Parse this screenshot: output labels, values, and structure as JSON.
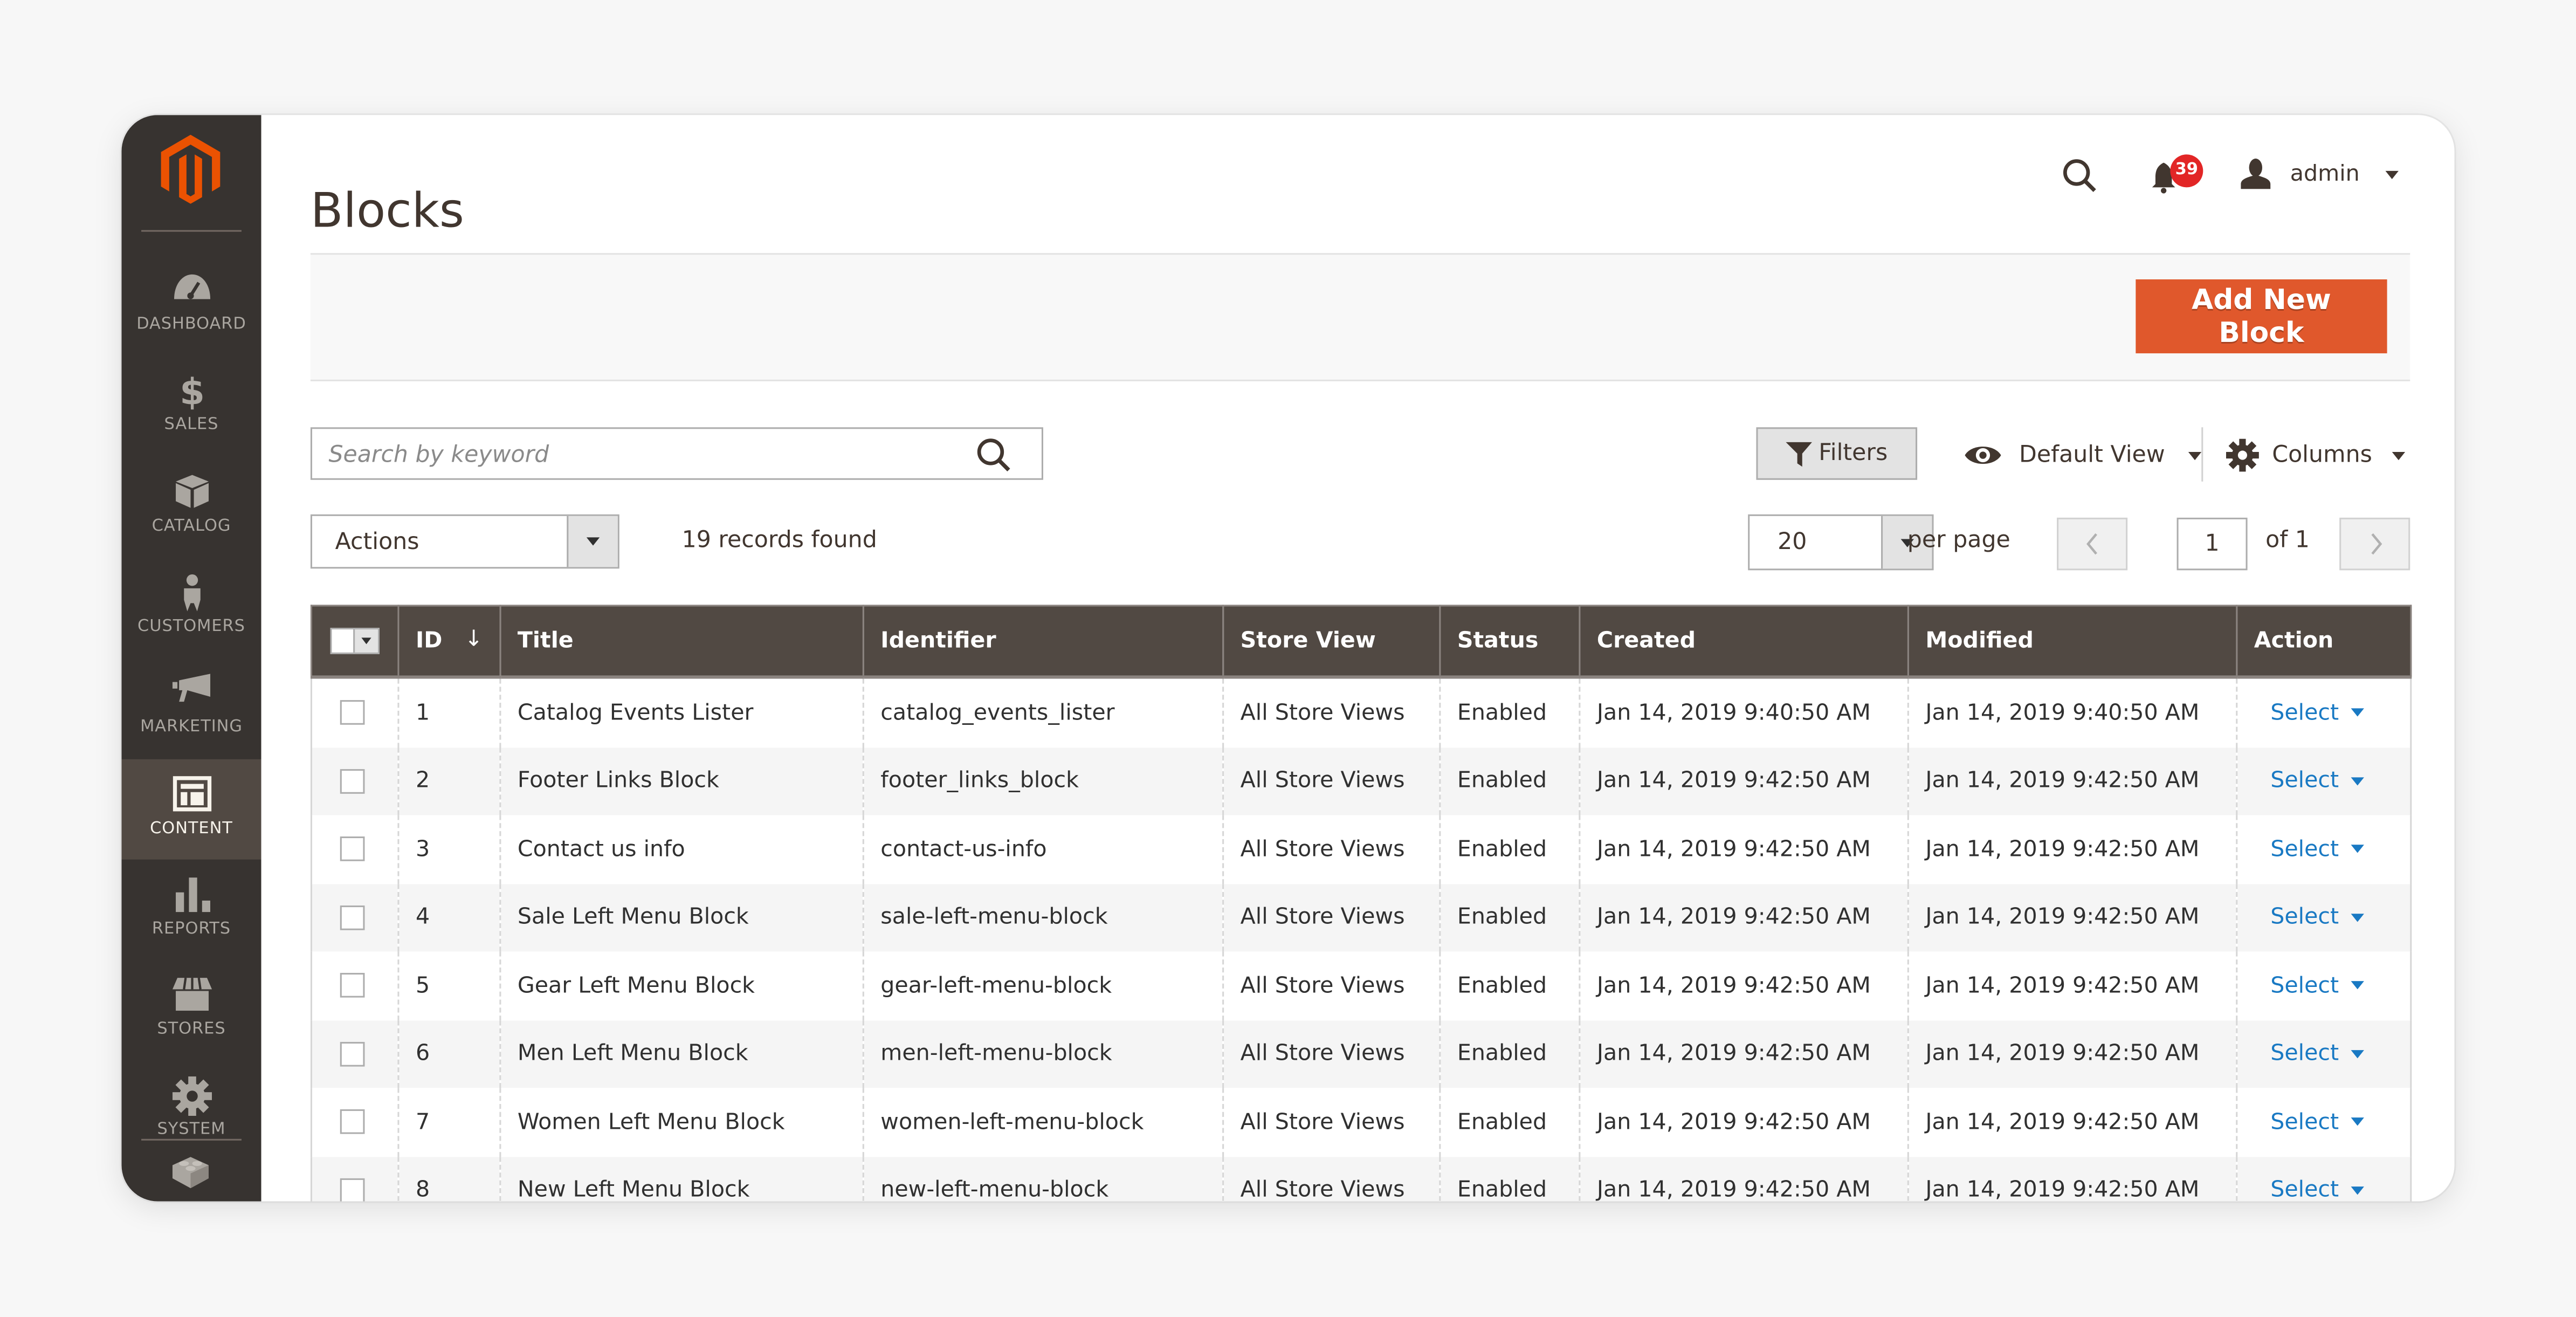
{
  "sidebar": {
    "logo": "magento-logo",
    "items": [
      {
        "label": "DASHBOARD",
        "icon": "dashboard-gauge-icon",
        "active": false
      },
      {
        "label": "SALES",
        "icon": "dollar-icon",
        "active": false
      },
      {
        "label": "CATALOG",
        "icon": "box-icon",
        "active": false
      },
      {
        "label": "CUSTOMERS",
        "icon": "person-icon",
        "active": false
      },
      {
        "label": "MARKETING",
        "icon": "megaphone-icon",
        "active": false
      },
      {
        "label": "CONTENT",
        "icon": "layout-icon",
        "active": true
      },
      {
        "label": "REPORTS",
        "icon": "bar-chart-icon",
        "active": false
      },
      {
        "label": "STORES",
        "icon": "storefront-icon",
        "active": false
      },
      {
        "label": "SYSTEM",
        "icon": "gear-icon",
        "active": false
      }
    ],
    "extra_icon": "lego-brick-icon"
  },
  "header": {
    "title": "Blocks",
    "notifications_count": "39",
    "user": "admin"
  },
  "toolbar": {
    "add_button": "Add New Block",
    "search_placeholder": "Search by keyword",
    "filters_label": "Filters",
    "view_label": "Default View",
    "columns_label": "Columns",
    "actions_label": "Actions",
    "records_found": "19 records found",
    "per_page_value": "20",
    "per_page_label": "per page",
    "current_page": "1",
    "total_pages_label": "of 1"
  },
  "colors": {
    "accent": "#e0582c",
    "sidebar_bg": "#373330",
    "table_header_bg": "#514943",
    "link": "#1979c3",
    "badge": "#e22626"
  },
  "table": {
    "columns": [
      "ID",
      "Title",
      "Identifier",
      "Store View",
      "Status",
      "Created",
      "Modified",
      "Action"
    ],
    "rows": [
      {
        "id": "1",
        "title": "Catalog Events Lister",
        "identifier": "catalog_events_lister",
        "store_view": "All Store Views",
        "status": "Enabled",
        "created": "Jan 14, 2019 9:40:50 AM",
        "modified": "Jan 14, 2019 9:40:50 AM",
        "action": "Select"
      },
      {
        "id": "2",
        "title": "Footer Links Block",
        "identifier": "footer_links_block",
        "store_view": "All Store Views",
        "status": "Enabled",
        "created": "Jan 14, 2019 9:42:50 AM",
        "modified": "Jan 14, 2019 9:42:50 AM",
        "action": "Select"
      },
      {
        "id": "3",
        "title": "Contact us info",
        "identifier": "contact-us-info",
        "store_view": "All Store Views",
        "status": "Enabled",
        "created": "Jan 14, 2019 9:42:50 AM",
        "modified": "Jan 14, 2019 9:42:50 AM",
        "action": "Select"
      },
      {
        "id": "4",
        "title": "Sale Left Menu Block",
        "identifier": "sale-left-menu-block",
        "store_view": "All Store Views",
        "status": "Enabled",
        "created": "Jan 14, 2019 9:42:50 AM",
        "modified": "Jan 14, 2019 9:42:50 AM",
        "action": "Select"
      },
      {
        "id": "5",
        "title": "Gear Left Menu Block",
        "identifier": "gear-left-menu-block",
        "store_view": "All Store Views",
        "status": "Enabled",
        "created": "Jan 14, 2019 9:42:50 AM",
        "modified": "Jan 14, 2019 9:42:50 AM",
        "action": "Select"
      },
      {
        "id": "6",
        "title": "Men Left Menu Block",
        "identifier": "men-left-menu-block",
        "store_view": "All Store Views",
        "status": "Enabled",
        "created": "Jan 14, 2019 9:42:50 AM",
        "modified": "Jan 14, 2019 9:42:50 AM",
        "action": "Select"
      },
      {
        "id": "7",
        "title": "Women Left Menu Block",
        "identifier": "women-left-menu-block",
        "store_view": "All Store Views",
        "status": "Enabled",
        "created": "Jan 14, 2019 9:42:50 AM",
        "modified": "Jan 14, 2019 9:42:50 AM",
        "action": "Select"
      },
      {
        "id": "8",
        "title": "New Left Menu Block",
        "identifier": "new-left-menu-block",
        "store_view": "All Store Views",
        "status": "Enabled",
        "created": "Jan 14, 2019 9:42:50 AM",
        "modified": "Jan 14, 2019 9:42:50 AM",
        "action": "Select"
      }
    ]
  }
}
